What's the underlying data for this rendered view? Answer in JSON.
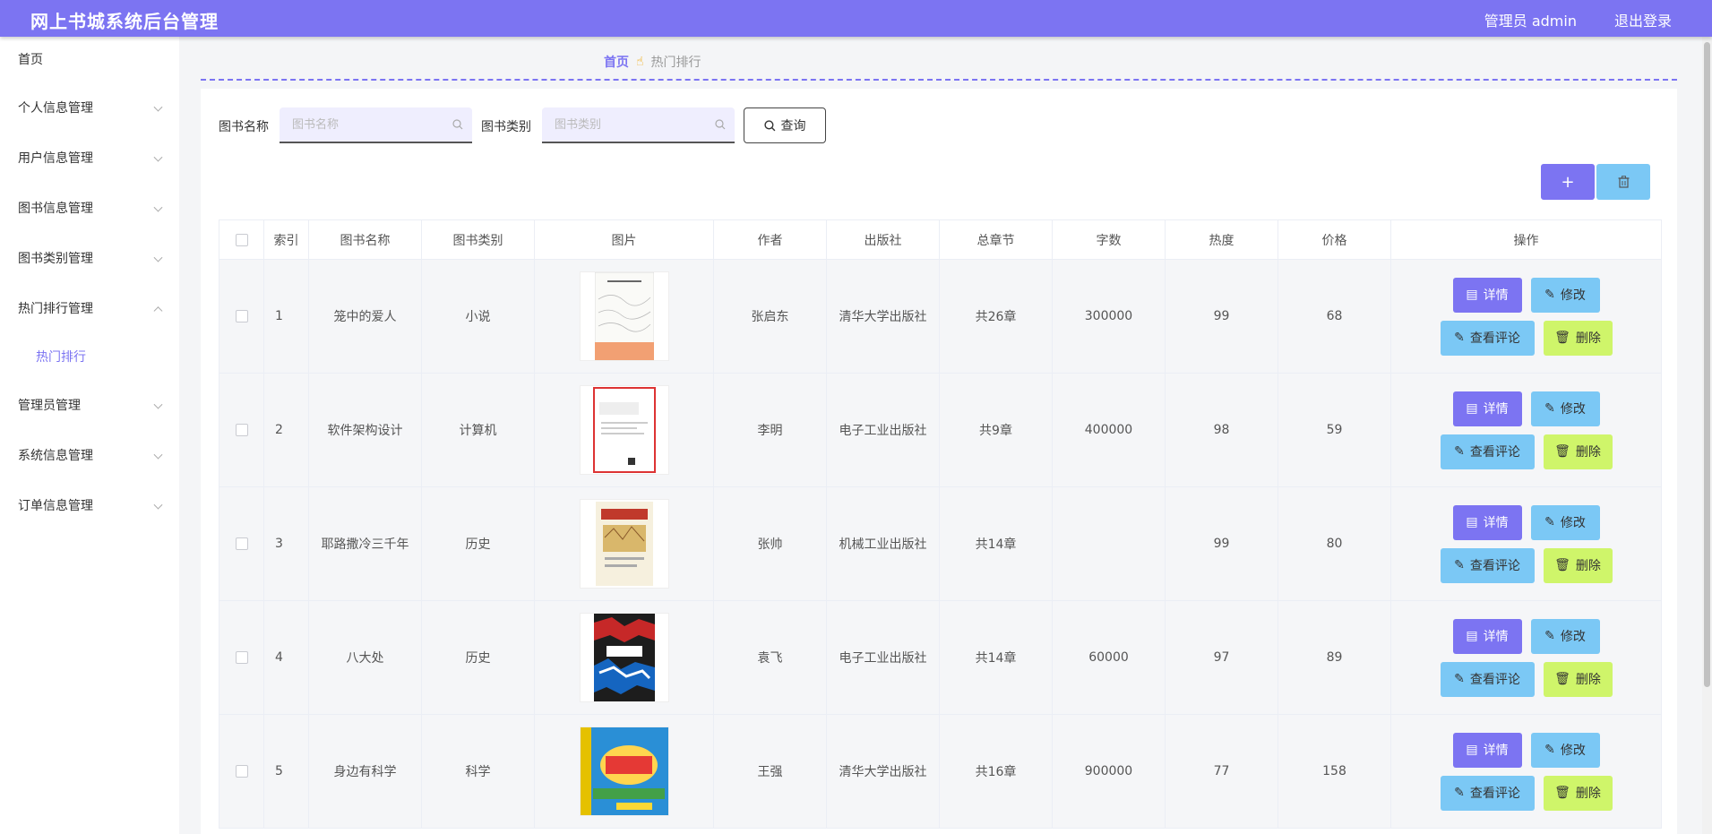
{
  "header": {
    "title": "网上书城系统后台管理",
    "user": "管理员 admin",
    "logout": "退出登录"
  },
  "sidebar": {
    "home": "首页",
    "items": [
      {
        "label": "个人信息管理",
        "expanded": false
      },
      {
        "label": "用户信息管理",
        "expanded": false
      },
      {
        "label": "图书信息管理",
        "expanded": false
      },
      {
        "label": "图书类别管理",
        "expanded": false
      },
      {
        "label": "热门排行管理",
        "expanded": true,
        "children": [
          "热门排行"
        ]
      },
      {
        "label": "管理员管理",
        "expanded": false
      },
      {
        "label": "系统信息管理",
        "expanded": false
      },
      {
        "label": "订单信息管理",
        "expanded": false
      }
    ]
  },
  "breadcrumb": {
    "home": "首页",
    "current": "热门排行"
  },
  "search": {
    "name_label": "图书名称",
    "name_placeholder": "图书名称",
    "type_label": "图书类别",
    "type_placeholder": "图书类别",
    "query_label": "查询"
  },
  "toolbar": {
    "add_symbol": "+"
  },
  "table": {
    "columns": [
      "索引",
      "图书名称",
      "图书类别",
      "图片",
      "作者",
      "出版社",
      "总章节",
      "字数",
      "热度",
      "价格",
      "操作"
    ],
    "rows": [
      {
        "index": "1",
        "name": "笼中的爱人",
        "type": "小说",
        "author": "张启东",
        "publisher": "清华大学出版社",
        "chapters": "共26章",
        "words": "300000",
        "heat": "99",
        "price": "68"
      },
      {
        "index": "2",
        "name": "软件架构设计",
        "type": "计算机",
        "author": "李明",
        "publisher": "电子工业出版社",
        "chapters": "共9章",
        "words": "400000",
        "heat": "98",
        "price": "59"
      },
      {
        "index": "3",
        "name": "耶路撒冷三千年",
        "type": "历史",
        "author": "张帅",
        "publisher": "机械工业出版社",
        "chapters": "共14章",
        "words": "",
        "heat": "99",
        "price": "80"
      },
      {
        "index": "4",
        "name": "八大处",
        "type": "历史",
        "author": "袁飞",
        "publisher": "电子工业出版社",
        "chapters": "共14章",
        "words": "60000",
        "heat": "97",
        "price": "89"
      },
      {
        "index": "5",
        "name": "身边有科学",
        "type": "科学",
        "author": "王强",
        "publisher": "清华大学出版社",
        "chapters": "共16章",
        "words": "900000",
        "heat": "77",
        "price": "158"
      }
    ],
    "actions": {
      "detail": "详情",
      "edit": "修改",
      "comment": "查看评论",
      "delete": "删除"
    }
  },
  "colors": {
    "accent": "#7c74f2",
    "light_blue": "#7bc8f5",
    "lime": "#cff56a"
  }
}
